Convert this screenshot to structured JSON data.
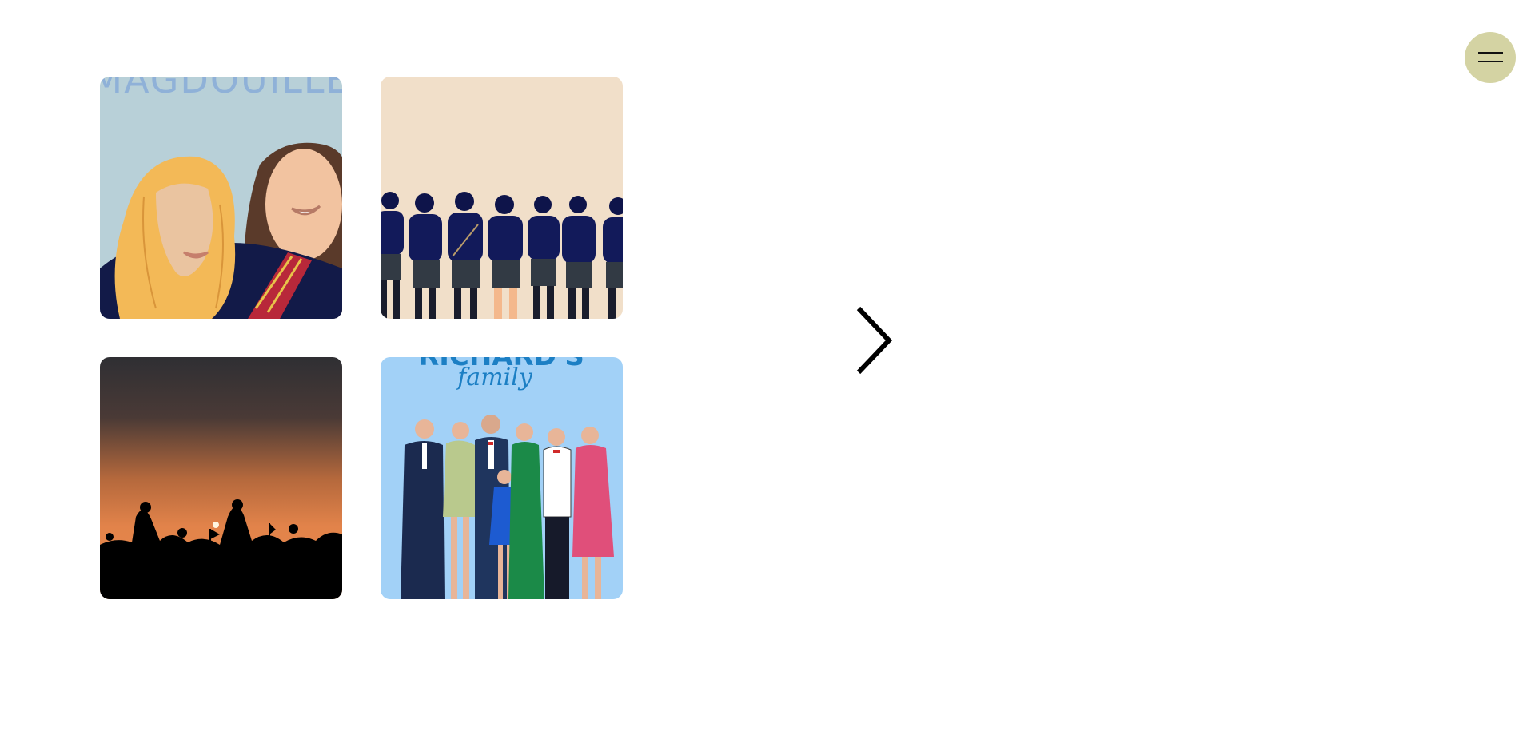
{
  "colors": {
    "background": "#ffffff",
    "menu_button": "#d4d3a3",
    "arrow": "#000000"
  },
  "gallery": {
    "tiles": [
      {
        "poster_text": "MAGDOUILLE"
      },
      {
        "poster_text": ""
      },
      {
        "poster_text": ""
      },
      {
        "poster_text": "RICHARD'S",
        "poster_subtext": "family"
      }
    ]
  },
  "navigation": {
    "next_icon": "chevron-right-icon",
    "menu_icon": "hamburger-menu-icon"
  }
}
